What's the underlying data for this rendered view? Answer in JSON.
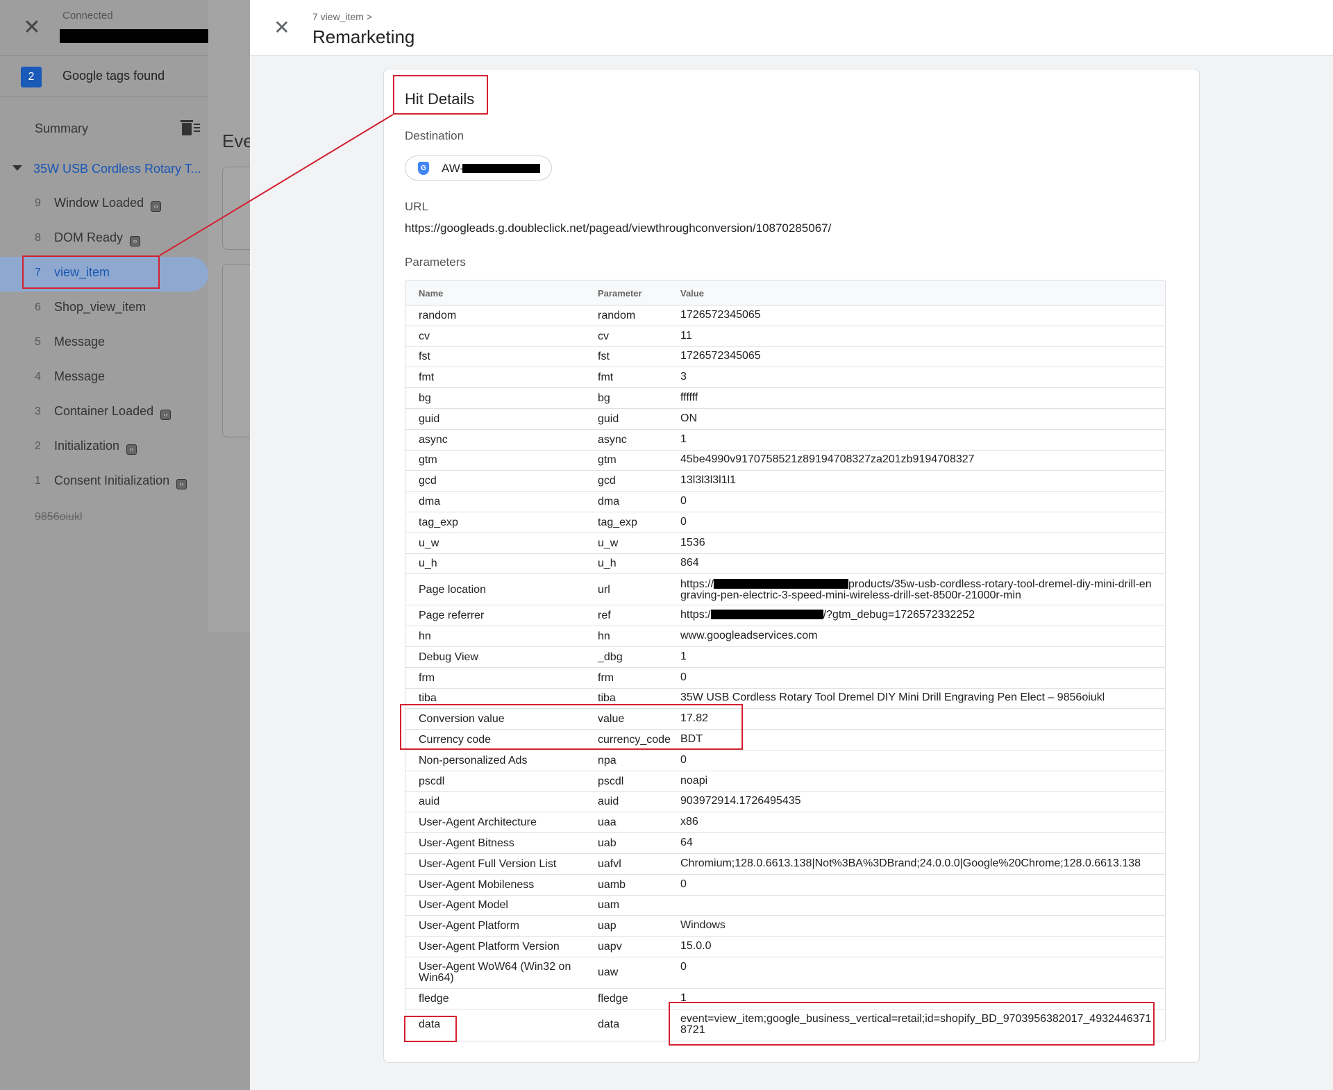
{
  "left": {
    "connection_status": "Connected",
    "tags_found_count": "2",
    "tags_found_label": "Google tags found",
    "summary_label": "Summary",
    "page_group_label": "35W USB Cordless Rotary T...",
    "events": [
      {
        "num": "9",
        "label": "Window Loaded",
        "api": true
      },
      {
        "num": "8",
        "label": "DOM Ready",
        "api": true
      },
      {
        "num": "7",
        "label": "view_item",
        "api": false,
        "selected": true
      },
      {
        "num": "6",
        "label": "Shop_view_item",
        "api": false
      },
      {
        "num": "5",
        "label": "Message",
        "api": false
      },
      {
        "num": "4",
        "label": "Message",
        "api": false
      },
      {
        "num": "3",
        "label": "Container Loaded",
        "api": true
      },
      {
        "num": "2",
        "label": "Initialization",
        "api": true
      },
      {
        "num": "1",
        "label": "Consent Initialization",
        "api": true
      }
    ],
    "struck_item": "9856oiukl",
    "events_heading_partial": "Eve"
  },
  "header": {
    "breadcrumb": "7 view_item >",
    "title": "Remarketing"
  },
  "hit": {
    "title": "Hit Details",
    "destination_label": "Destination",
    "destination_prefix": "AW-",
    "url_label": "URL",
    "url": "https://googleads.g.doubleclick.net/pagead/viewthroughconversion/10870285067/",
    "parameters_label": "Parameters",
    "columns": {
      "name": "Name",
      "parameter": "Parameter",
      "value": "Value"
    },
    "params": [
      {
        "name": "random",
        "param": "random",
        "value": "1726572345065"
      },
      {
        "name": "cv",
        "param": "cv",
        "value": "11"
      },
      {
        "name": "fst",
        "param": "fst",
        "value": "1726572345065"
      },
      {
        "name": "fmt",
        "param": "fmt",
        "value": "3"
      },
      {
        "name": "bg",
        "param": "bg",
        "value": "ffffff"
      },
      {
        "name": "guid",
        "param": "guid",
        "value": "ON"
      },
      {
        "name": "async",
        "param": "async",
        "value": "1"
      },
      {
        "name": "gtm",
        "param": "gtm",
        "value": "45be4990v9170758521z89194708327za201zb9194708327"
      },
      {
        "name": "gcd",
        "param": "gcd",
        "value": "13l3l3l3l1l1"
      },
      {
        "name": "dma",
        "param": "dma",
        "value": "0"
      },
      {
        "name": "tag_exp",
        "param": "tag_exp",
        "value": "0"
      },
      {
        "name": "u_w",
        "param": "u_w",
        "value": "1536"
      },
      {
        "name": "u_h",
        "param": "u_h",
        "value": "864"
      },
      {
        "name": "Page location",
        "param": "url",
        "value_prefix": "https://",
        "value_suffix": "products/35w-usb-cordless-rotary-tool-dremel-diy-mini-drill-engraving-pen-electric-3-speed-mini-wireless-drill-set-8500r-21000r-min",
        "redacted": true,
        "tall": true
      },
      {
        "name": "Page referrer",
        "param": "ref",
        "value_prefix": "https:/",
        "value_suffix": "/?gtm_debug=1726572332252",
        "redacted": true
      },
      {
        "name": "hn",
        "param": "hn",
        "value": "www.googleadservices.com"
      },
      {
        "name": "Debug View",
        "param": "_dbg",
        "value": "1"
      },
      {
        "name": "frm",
        "param": "frm",
        "value": "0"
      },
      {
        "name": "tiba",
        "param": "tiba",
        "value": "35W USB Cordless Rotary Tool Dremel DIY Mini Drill Engraving Pen Elect – 9856oiukl"
      },
      {
        "name": "Conversion value",
        "param": "value",
        "value": "17.82"
      },
      {
        "name": "Currency code",
        "param": "currency_code",
        "value": "BDT"
      },
      {
        "name": "Non-personalized Ads",
        "param": "npa",
        "value": "0"
      },
      {
        "name": "pscdl",
        "param": "pscdl",
        "value": "noapi"
      },
      {
        "name": "auid",
        "param": "auid",
        "value": "903972914.1726495435"
      },
      {
        "name": "User-Agent Architecture",
        "param": "uaa",
        "value": "x86"
      },
      {
        "name": "User-Agent Bitness",
        "param": "uab",
        "value": "64"
      },
      {
        "name": "User-Agent Full Version List",
        "param": "uafvl",
        "value": "Chromium;128.0.6613.138|Not%3BA%3DBrand;24.0.0.0|Google%20Chrome;128.0.6613.138"
      },
      {
        "name": "User-Agent Mobileness",
        "param": "uamb",
        "value": "0"
      },
      {
        "name": "User-Agent Model",
        "param": "uam",
        "value": ""
      },
      {
        "name": "User-Agent Platform",
        "param": "uap",
        "value": "Windows"
      },
      {
        "name": "User-Agent Platform Version",
        "param": "uapv",
        "value": "15.0.0"
      },
      {
        "name": "User-Agent WoW64 (Win32 on Win64)",
        "param": "uaw",
        "value": "0",
        "tall": true
      },
      {
        "name": "fledge",
        "param": "fledge",
        "value": "1"
      },
      {
        "name": "data",
        "param": "data",
        "value": "event=view_item;google_business_vertical=retail;id=shopify_BD_9703956382017_49324463718721",
        "tall": true
      }
    ]
  },
  "colors": {
    "accent": "#1a56b4",
    "annotation": "#d32030",
    "selected_bg": "#8ea8cf"
  }
}
